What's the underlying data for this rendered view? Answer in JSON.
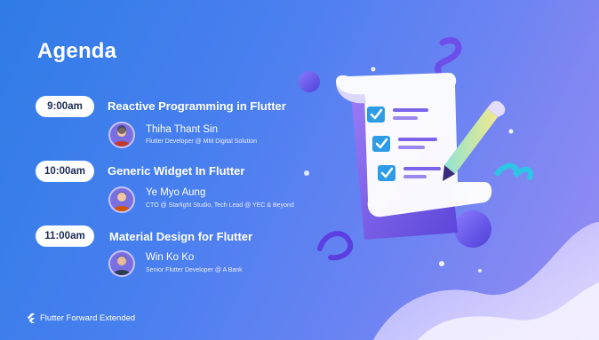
{
  "slide": {
    "title": "Agenda",
    "colors": {
      "bg_start": "#2f7ce6",
      "bg_end": "#9a8cf3",
      "pill_text": "#1b2a55",
      "check": "#2e9be6",
      "accent_purple": "#6d4ee8"
    },
    "sessions": [
      {
        "time": "9:00am",
        "title": "Reactive Programming in Flutter",
        "speaker": "Thiha Thant Sin",
        "role": "Flutter Developer @ MM Digital Solution"
      },
      {
        "time": "10:00am",
        "title": "Generic Widget In Flutter",
        "speaker": "Ye Myo Aung",
        "role": "CTO @ Starlight Studio, Tech Lead @ YEC & Beyond"
      },
      {
        "time": "11:00am",
        "title": "Material Design for Flutter",
        "speaker": "Win Ko Ko",
        "role": "Senior Flutter Developer @ A Bank"
      }
    ],
    "footer": {
      "icon": "flutter-logo-icon",
      "text": "Flutter Forward Extended"
    },
    "illustration": {
      "icons": [
        "checklist-scroll-icon",
        "pencil-icon",
        "check-icon"
      ]
    }
  }
}
